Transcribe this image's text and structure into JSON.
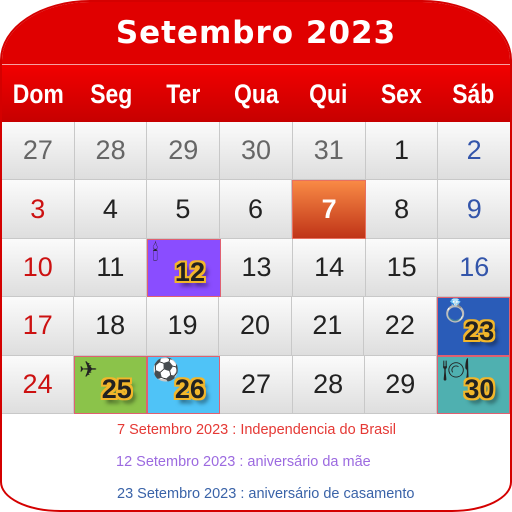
{
  "header": {
    "title": "Setembro 2023"
  },
  "weekdays": [
    "Dom",
    "Seg",
    "Ter",
    "Qua",
    "Qui",
    "Sex",
    "Sáb"
  ],
  "colors": {
    "title_bar": "#e00000",
    "today": "#e0582a",
    "sunday_text": "#cc1111",
    "saturday_text": "#3355aa",
    "event_birthday": "#8a4dff",
    "event_travel": "#8bc34a",
    "event_soccer": "#4fc3f7",
    "event_wedding": "#2a5cb8",
    "event_dinner": "#4fb0b0"
  },
  "weeks": [
    [
      {
        "d": "27",
        "t": "other"
      },
      {
        "d": "28",
        "t": "other"
      },
      {
        "d": "29",
        "t": "other"
      },
      {
        "d": "30",
        "t": "other"
      },
      {
        "d": "31",
        "t": "other"
      },
      {
        "d": "1",
        "t": "normal"
      },
      {
        "d": "2",
        "t": "sat"
      }
    ],
    [
      {
        "d": "3",
        "t": "sun"
      },
      {
        "d": "4",
        "t": "normal"
      },
      {
        "d": "5",
        "t": "normal"
      },
      {
        "d": "6",
        "t": "normal"
      },
      {
        "d": "7",
        "t": "today"
      },
      {
        "d": "8",
        "t": "normal"
      },
      {
        "d": "9",
        "t": "sat"
      }
    ],
    [
      {
        "d": "10",
        "t": "sun"
      },
      {
        "d": "11",
        "t": "normal"
      },
      {
        "d": "12",
        "t": "event",
        "icon": "birthday-candles-icon",
        "glyph": "🕯",
        "bg": "#8a4dff"
      },
      {
        "d": "13",
        "t": "normal"
      },
      {
        "d": "14",
        "t": "normal"
      },
      {
        "d": "15",
        "t": "normal"
      },
      {
        "d": "16",
        "t": "sat"
      }
    ],
    [
      {
        "d": "17",
        "t": "sun"
      },
      {
        "d": "18",
        "t": "normal"
      },
      {
        "d": "19",
        "t": "normal"
      },
      {
        "d": "20",
        "t": "normal"
      },
      {
        "d": "21",
        "t": "normal"
      },
      {
        "d": "22",
        "t": "normal"
      },
      {
        "d": "23",
        "t": "event",
        "icon": "wedding-ring-icon",
        "glyph": "💍",
        "bg": "#2a5cb8"
      }
    ],
    [
      {
        "d": "24",
        "t": "sun"
      },
      {
        "d": "25",
        "t": "event",
        "icon": "airplane-icon",
        "glyph": "✈",
        "bg": "#8bc34a"
      },
      {
        "d": "26",
        "t": "event",
        "icon": "soccer-ball-icon",
        "glyph": "⚽",
        "bg": "#4fc3f7"
      },
      {
        "d": "27",
        "t": "normal"
      },
      {
        "d": "28",
        "t": "normal"
      },
      {
        "d": "29",
        "t": "normal"
      },
      {
        "d": "30",
        "t": "event",
        "icon": "dinner-plate-icon",
        "glyph": "🍽",
        "bg": "#4fb0b0"
      }
    ]
  ],
  "events": [
    {
      "text": "7 Setembro 2023 : Independencia do Brasil",
      "color": "#e53935"
    },
    {
      "text": "12 Setembro 2023 : aniversário da mãe",
      "color": "#9c6ae0"
    },
    {
      "text": "23 Setembro 2023 : aniversário de casamento",
      "color": "#3a63a8"
    }
  ]
}
